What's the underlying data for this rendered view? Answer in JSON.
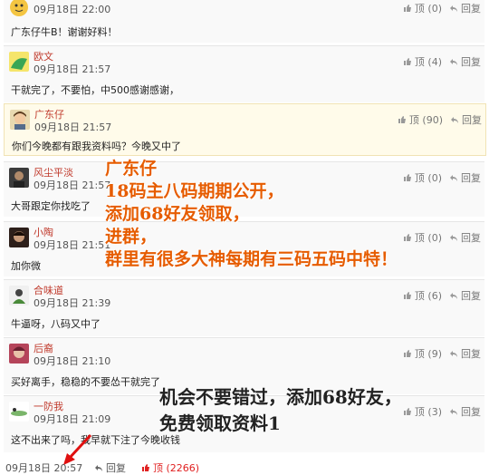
{
  "comments": [
    {
      "author": "",
      "time": "09月18日 22:00",
      "text": "广东仔牛B！谢谢好料！",
      "likes": "顶 (0)",
      "reply": "回复"
    },
    {
      "author": "欧文",
      "time": "09月18日 21:57",
      "text": "干就完了，不要怕，中500感谢感谢，",
      "likes": "顶 (4)",
      "reply": "回复"
    },
    {
      "author": "广东仔",
      "time": "09月18日 21:57",
      "text": "你们今晚都有跟我资料吗？今晚又中了",
      "likes": "顶 (90)",
      "reply": "回复"
    },
    {
      "author": "风尘平淡",
      "time": "09月18日 21:57",
      "text": "大哥跟定你找吃了",
      "likes": "顶 (0)",
      "reply": "回复"
    },
    {
      "author": "小陶",
      "time": "09月18日 21:51",
      "text": "加你微",
      "likes": "顶 (0)",
      "reply": "回复"
    },
    {
      "author": "合味道",
      "time": "09月18日 21:39",
      "text": "牛逼呀，八码又中了",
      "likes": "顶 (6)",
      "reply": "回复"
    },
    {
      "author": "后裔",
      "time": "09月18日 21:10",
      "text": "买好离手，稳稳的不要怂干就完了",
      "likes": "顶 (9)",
      "reply": "回复"
    },
    {
      "author": "一防我",
      "time": "09月18日 21:09",
      "text": "这不出来了吗，我早就下注了今晚收钱",
      "likes": "顶 (3)",
      "reply": "回复"
    }
  ],
  "overlay_text": {
    "line1": "广东仔",
    "line2": "18码主八码期期公开，",
    "line3": "添加68好友领取，",
    "line4": "进群，",
    "line5": "群里有很多大神每期有三码五码中特！"
  },
  "overlay_text2": {
    "line1": "机会不要错过，添加68好友，",
    "line2": "免费领取资料1"
  },
  "footer": {
    "time": "09月18日 20:57",
    "reply": "回复",
    "likes": "顶 (2266)"
  },
  "colors": {
    "accent": "#e65c00",
    "author": "#c0392b",
    "like_hot": "#e02020"
  }
}
